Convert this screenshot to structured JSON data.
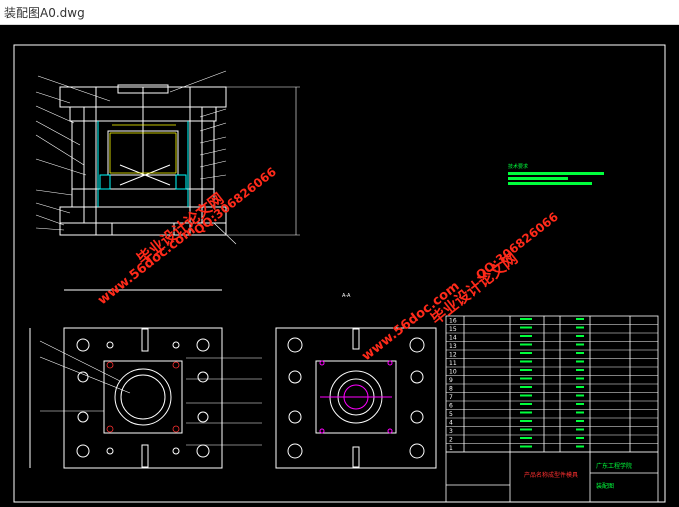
{
  "window": {
    "title": "装配图A0.dwg"
  },
  "drawing": {
    "tech_requirements_title": "技术要求",
    "school_name": "广东工程学院",
    "drawing_title": "装配图",
    "product_name": "产品名称成型件模具",
    "bom_rows": [
      "16",
      "15",
      "14",
      "13",
      "12",
      "11",
      "10",
      "9",
      "8",
      "7",
      "6",
      "5",
      "4",
      "3",
      "2",
      "1"
    ],
    "section_label": "A-A"
  },
  "watermarks": {
    "site": "www.56doc.com",
    "brand": "毕业设计论文网",
    "qq": "QQ:306826066"
  },
  "colors": {
    "background": "#000000",
    "outline": "#ffffff",
    "green": "#00ff3c",
    "yellow": "#ffff00",
    "magenta": "#ff00ff",
    "cyan": "#00ffff",
    "watermark": "#ff2a1a"
  }
}
